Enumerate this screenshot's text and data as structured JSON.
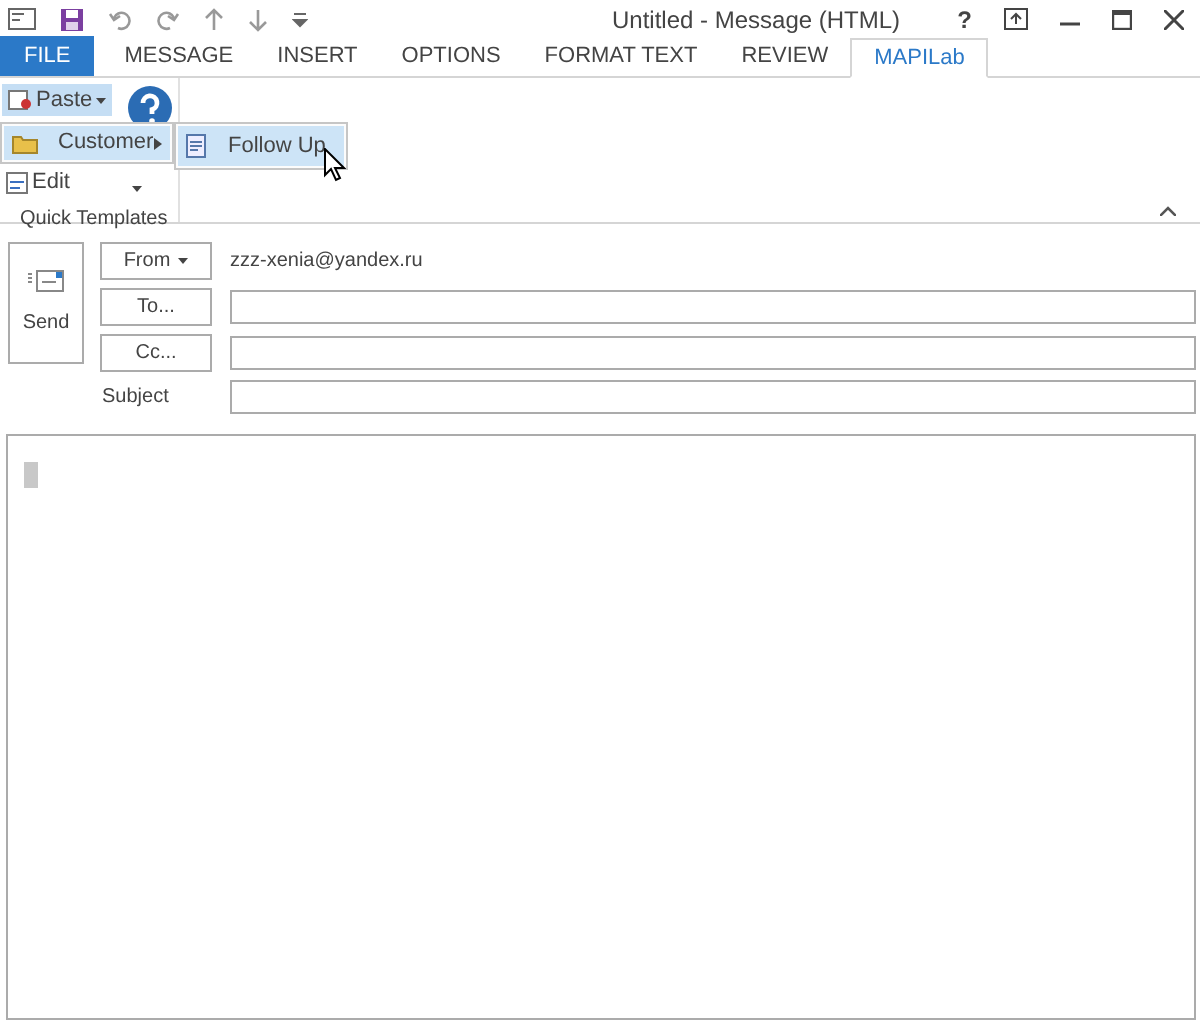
{
  "window": {
    "title": "Untitled - Message (HTML)",
    "help": "?"
  },
  "tabs": [
    {
      "label": "FILE",
      "kind": "file",
      "selected": false
    },
    {
      "label": "MESSAGE",
      "kind": "tab",
      "selected": false
    },
    {
      "label": "INSERT",
      "kind": "tab",
      "selected": false
    },
    {
      "label": "OPTIONS",
      "kind": "tab",
      "selected": false
    },
    {
      "label": "FORMAT TEXT",
      "kind": "tab",
      "selected": false
    },
    {
      "label": "REVIEW",
      "kind": "tab",
      "selected": false
    },
    {
      "label": "MAPILab",
      "kind": "tab",
      "selected": true
    }
  ],
  "ribbon": {
    "paste": "Paste",
    "edit": "Edit",
    "group": "Quick Templates"
  },
  "menu": {
    "items": [
      {
        "label": "Customer",
        "selected": true
      }
    ],
    "submenu": [
      {
        "label": "Follow Up",
        "selected": true
      }
    ]
  },
  "compose": {
    "send": "Send",
    "from": "From",
    "from_value": "zzz-xenia@yandex.ru",
    "to": "To...",
    "cc": "Cc...",
    "subject": "Subject"
  }
}
